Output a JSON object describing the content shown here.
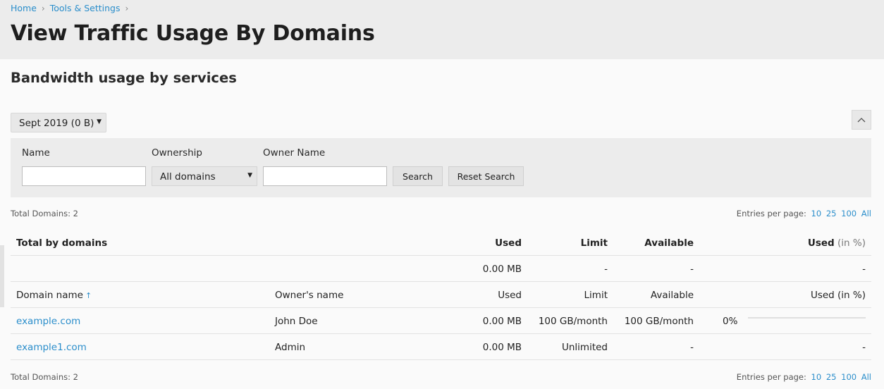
{
  "breadcrumb": [
    {
      "label": "Home"
    },
    {
      "label": "Tools & Settings"
    }
  ],
  "page_title": "View Traffic Usage By Domains",
  "section_title": "Bandwidth usage by services",
  "period": {
    "selected": "Sept 2019 (0 B)"
  },
  "filters": {
    "name_label": "Name",
    "name_value": "",
    "ownership_label": "Ownership",
    "ownership_value": "All domains",
    "owner_name_label": "Owner Name",
    "owner_name_value": "",
    "search_label": "Search",
    "reset_label": "Reset Search"
  },
  "total_domains_label": "Total Domains: 2",
  "entries": {
    "label": "Entries per page:",
    "options": [
      "10",
      "25",
      "100",
      "All"
    ]
  },
  "totals": {
    "header": {
      "title": "Total by domains",
      "used": "Used",
      "limit": "Limit",
      "available": "Available",
      "used_pct": "Used",
      "used_pct_unit": "(in %)"
    },
    "row": {
      "used": "0.00 MB",
      "limit": "-",
      "available": "-",
      "used_pct": "-"
    }
  },
  "columns": {
    "domain": "Domain name",
    "owner": "Owner's name",
    "used": "Used",
    "limit": "Limit",
    "available": "Available",
    "used_pct": "Used (in %)"
  },
  "rows": [
    {
      "domain": "example.com",
      "owner": "John Doe",
      "used": "0.00 MB",
      "limit": "100 GB/month",
      "available": "100 GB/month",
      "used_pct": "0%",
      "usage_fraction": 0
    },
    {
      "domain": "example1.com",
      "owner": "Admin",
      "used": "0.00 MB",
      "limit": "Unlimited",
      "available": "-",
      "used_pct": "-"
    }
  ],
  "colors": {
    "link": "#2b8ecb",
    "header_bg": "#ececec",
    "page_bg": "#fafafa"
  },
  "icons": {
    "breadcrumb_separator": "chevron-right-icon",
    "collapse": "chevron-up-icon",
    "dropdown": "caret-down-icon",
    "sort": "sort-ascending-arrow-icon"
  }
}
